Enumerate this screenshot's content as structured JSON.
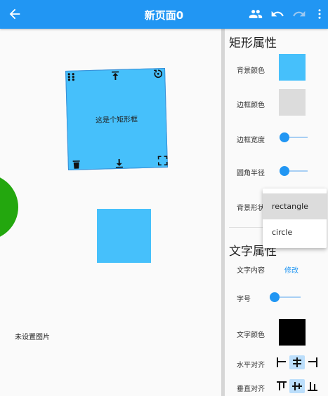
{
  "appbar": {
    "title": "新页面0",
    "icons": [
      "arrow-back-icon",
      "people-icon",
      "undo-icon",
      "redo-icon",
      "more-vert-icon"
    ],
    "color": "#2196f3"
  },
  "canvas": {
    "selected_rect_label": "这是个矩形框",
    "no_image_label": "未设置图片",
    "rect_color": "#46c0fb",
    "blob_color": "#23a70e"
  },
  "panel": {
    "rect_section_title": "矩形属性",
    "bg_color_label": "背景颜色",
    "border_color_label": "边框颜色",
    "border_width_label": "边框宽度",
    "corner_radius_label": "圆角半径",
    "bg_shape_label": "背景形状",
    "text_section_title": "文字属性",
    "text_content_label": "文字内容",
    "edit_link": "修改",
    "font_size_label": "字号",
    "text_color_label": "文字颜色",
    "h_align_label": "水平对齐",
    "v_align_label": "垂直对齐",
    "bg_color_value": "#46c0fb",
    "border_color_value": "#dcdcdc",
    "text_color_value": "#000000",
    "border_width_value": 0,
    "corner_radius_value": 0,
    "font_size_value": 0
  },
  "dropdown": {
    "options": [
      "rectangle",
      "circle"
    ],
    "selected": "rectangle"
  }
}
